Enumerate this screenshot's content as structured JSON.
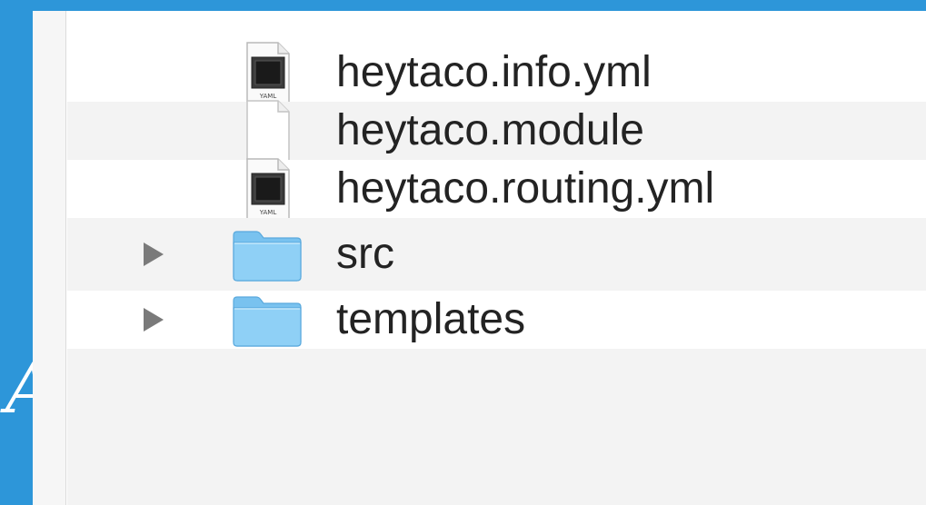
{
  "backdrop": {
    "letter": "A"
  },
  "files": [
    {
      "name": "heytaco.info.yml",
      "icon": "yaml-file-icon",
      "badge": "YAML"
    },
    {
      "name": "heytaco.module",
      "icon": "blank-document-icon"
    },
    {
      "name": "heytaco.routing.yml",
      "icon": "yaml-file-icon",
      "badge": "YAML"
    },
    {
      "name": "src",
      "icon": "folder-icon"
    },
    {
      "name": "templates",
      "icon": "folder-icon"
    }
  ],
  "colors": {
    "backdrop": "#2d96d9",
    "stripe": "#f3f3f3",
    "folder": "#7cc7f2",
    "text": "#232323"
  }
}
